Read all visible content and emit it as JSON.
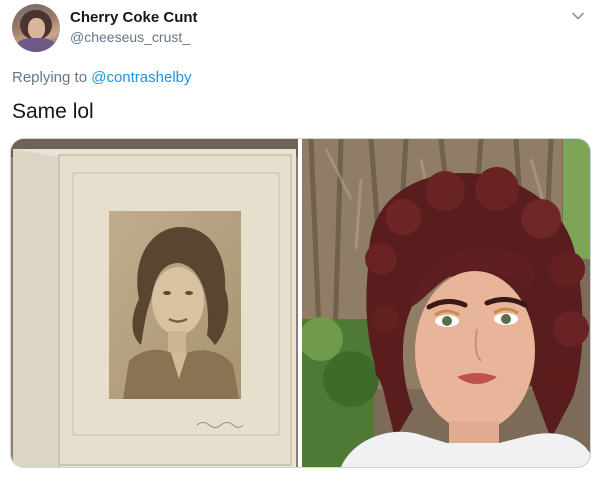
{
  "tweet": {
    "display_name": "Cherry Coke Cunt",
    "handle": "@cheeseus_crust_",
    "replying_prefix": "Replying to ",
    "replying_to": "@contrashelby",
    "text": "Same lol"
  },
  "icons": {
    "menu": "chevron-down-icon"
  },
  "media": {
    "left_image": "vintage-portrait-photo",
    "right_image": "selfie-photo"
  }
}
